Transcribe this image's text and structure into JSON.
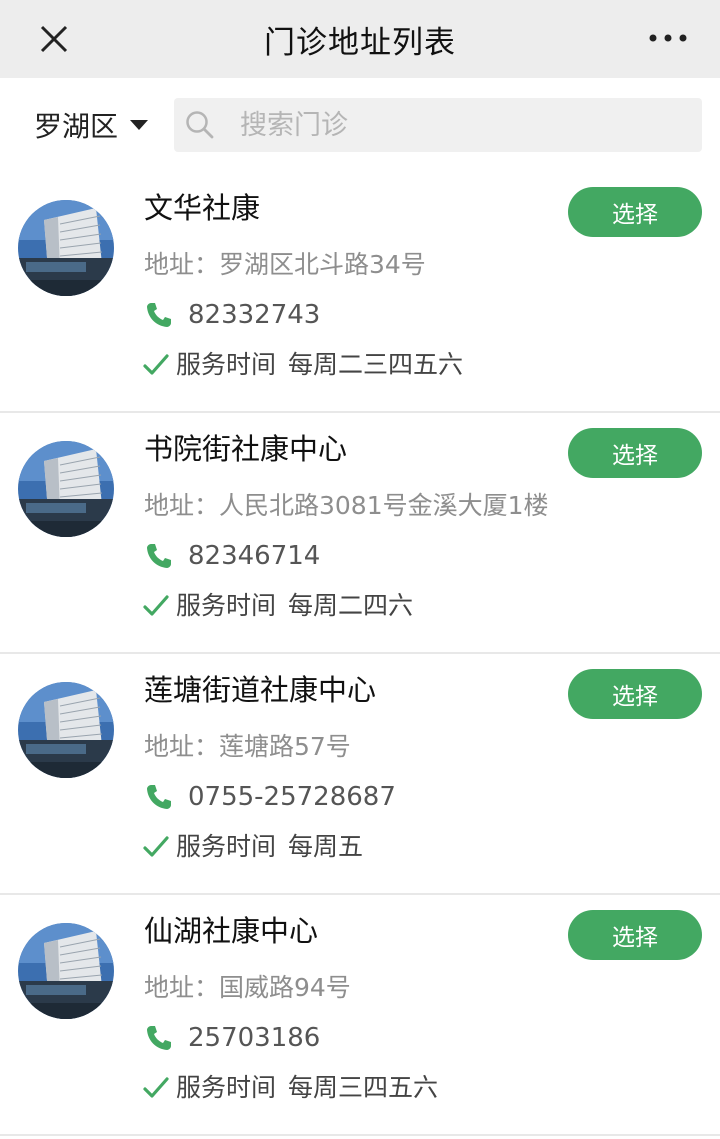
{
  "navbar": {
    "title": "门诊地址列表"
  },
  "filter": {
    "district": "罗湖区",
    "search_placeholder": "搜索门诊"
  },
  "clinics": [
    {
      "name": "文华社康",
      "address": "地址：罗湖区北斗路34号",
      "phone": "82332743",
      "hours_label": "服务时间",
      "hours": "每周二三四五六",
      "button": "选择"
    },
    {
      "name": "书院街社康中心",
      "address": "地址：人民北路3081号金溪大厦1楼",
      "phone": "82346714",
      "hours_label": "服务时间",
      "hours": "每周二四六",
      "button": "选择"
    },
    {
      "name": "莲塘街道社康中心",
      "address": "地址：莲塘路57号",
      "phone": "0755-25728687",
      "hours_label": "服务时间",
      "hours": "每周五",
      "button": "选择"
    },
    {
      "name": "仙湖社康中心",
      "address": "地址：国威路94号",
      "phone": "25703186",
      "hours_label": "服务时间",
      "hours": "每周三四五六",
      "button": "选择"
    }
  ],
  "colors": {
    "accent": "#43a862",
    "navbar_bg": "#ededed",
    "muted_text": "#8e8e8e"
  },
  "icons": {
    "close": "close-icon",
    "more": "more-icon",
    "search": "search-icon",
    "phone": "phone-icon",
    "check": "check-icon",
    "dropdown": "caret-down-icon"
  }
}
